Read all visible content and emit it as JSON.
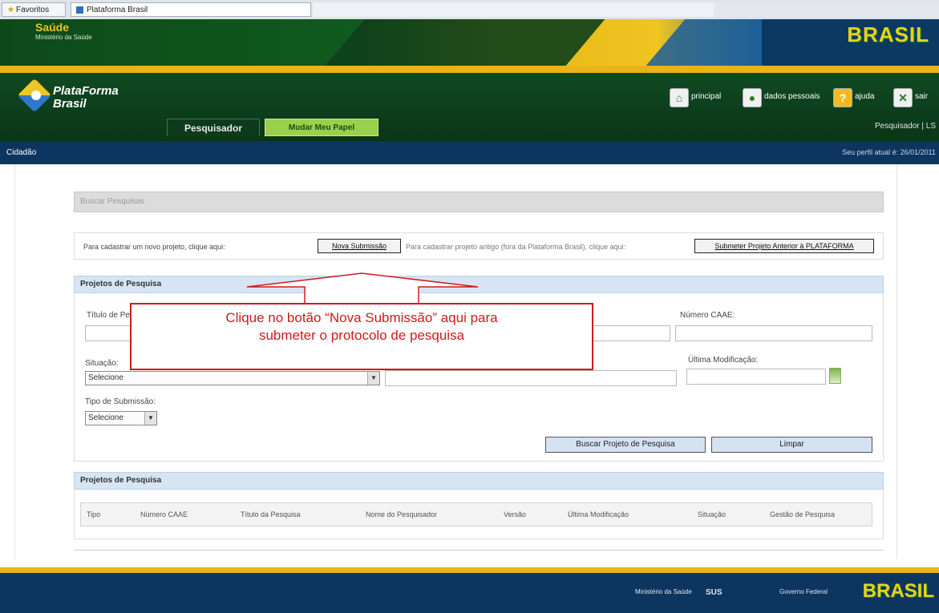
{
  "browser": {
    "tab1": "Favoritos",
    "tab2": "Plataforma Brasil"
  },
  "gov_banner": {
    "title": "Saúde",
    "subtitle": "Ministério da Saúde",
    "brasil": "BRASIL"
  },
  "app": {
    "logo_line1": "PlataForma",
    "logo_line2": "Brasil",
    "tabs": [
      {
        "label": "Pesquisador"
      },
      {
        "label": "Mudar Meu Papel"
      }
    ],
    "header_links": {
      "home": "principal",
      "user": "dados pessoais",
      "help": "ajuda",
      "exit": "sair"
    },
    "user_role": "Pesquisador | LS",
    "nav_left": "Cidadão",
    "nav_right": "Seu perfil atual é: 26/01/2011"
  },
  "page": {
    "breadcrumb": "Buscar Pesquisas",
    "submit_text": "Para cadastrar um novo projeto, clique aqui:",
    "submit_button": "Nova Submissão",
    "submit_text2": "Para cadastrar projeto antigo (fora da Plataforma Brasil), clique aqui:",
    "submit_button2": "Submeter Projeto Anterior à PLATAFORMA",
    "section1_title": "Projetos de Pesquisa",
    "fields": {
      "titulo_label": "Título de Pesquisa:",
      "caae_label": "Número CAAE:",
      "situacao_label": "Situação:",
      "situacao_value": "Selecione",
      "ultima_mod_label": "Última Modificação:",
      "tipo_label": "Tipo de Submissão:",
      "tipo_value": "Selecione"
    },
    "btn_buscar": "Buscar Projeto de Pesquisa",
    "btn_limpar": "Limpar",
    "section2_title": "Projetos de Pesquisa",
    "table_headers": [
      "Tipo",
      "Número CAAE",
      "Título da Pesquisa",
      "Nome do Pesquisador",
      "Versão",
      "Última Modificação",
      "Situação",
      "Gestão de Pesquisa"
    ]
  },
  "annotation": {
    "line1": "Clique no botão “Nova Submissão” aqui para",
    "line2": "submeter o protocolo de pesquisa",
    "color": "#d01a1a"
  },
  "footer": {
    "logo1": "Ministério da Saúde",
    "logo2": "SUS",
    "logo3": "Governo Federal",
    "brasil": "BRASIL"
  }
}
